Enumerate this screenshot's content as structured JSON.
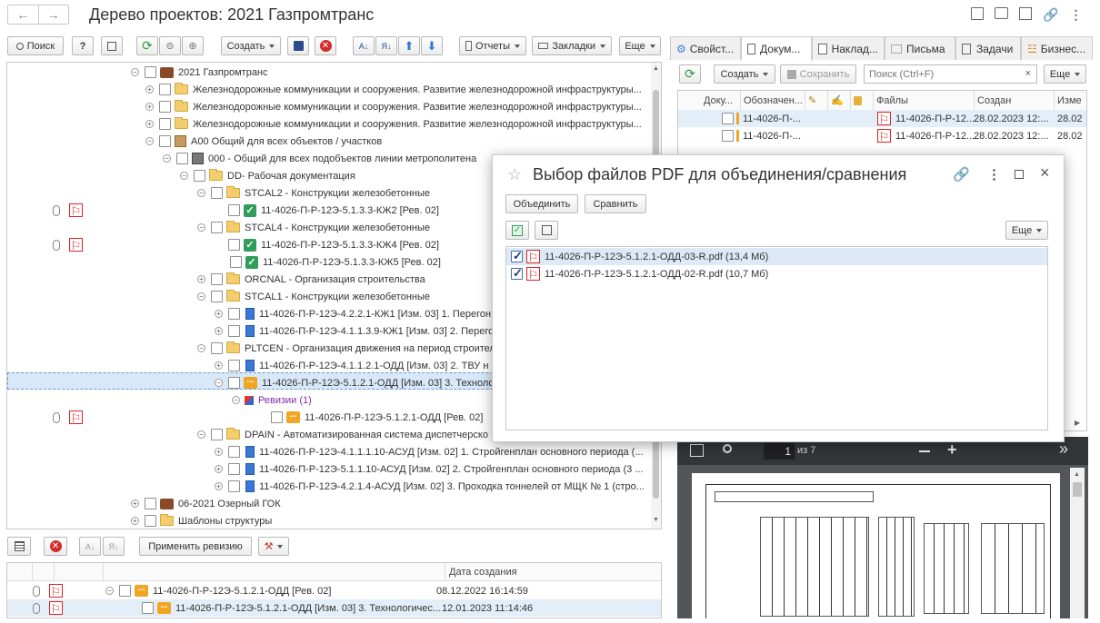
{
  "window": {
    "title": "Дерево проектов: 2021 Газпромтранс"
  },
  "toolbar": {
    "search": "Поиск",
    "help": "?",
    "create": "Создать",
    "reports": "Отчеты",
    "bookmarks": "Закладки",
    "more": "Еще"
  },
  "tree": {
    "rows": [
      {
        "label": "2021 Газпромтранс"
      },
      {
        "label": "Железнодорожные коммуникации и сооружения. Развитие железнодорожной инфраструктуры..."
      },
      {
        "label": "Железнодорожные коммуникации и сооружения. Развитие железнодорожной инфраструктуры..."
      },
      {
        "label": "Железнодорожные коммуникации и сооружения. Развитие железнодорожной инфраструктуры..."
      },
      {
        "label": "А00 Общий для всех объектов / участков"
      },
      {
        "label": "000 - Общий для всех подобъектов линии метрополитена"
      },
      {
        "label": "DD- Рабочая документация"
      },
      {
        "label": "STCAL2 - Конструкции железобетонные"
      },
      {
        "label": "11-4026-П-Р-12Э-5.1.3.3-КЖ2 [Рев. 02]"
      },
      {
        "label": "STCAL4 - Конструкции железобетонные"
      },
      {
        "label": "11-4026-П-Р-12Э-5.1.3.3-КЖ4 [Рев. 02]"
      },
      {
        "label": "11-4026-П-Р-12Э-5.1.3.3-КЖ5 [Рев. 02]"
      },
      {
        "label": "ORCNAL - Организация строительства"
      },
      {
        "label": "STCAL1 - Конструкции железобетонные"
      },
      {
        "label": "11-4026-П-Р-12Э-4.2.2.1-КЖ1 [Изм. 03] 1. Перегон"
      },
      {
        "label": "11-4026-П-Р-12Э-4.1.1.3.9-КЖ1 [Изм. 03] 2. Перего"
      },
      {
        "label": "PLTCEN - Организация движения на период строител"
      },
      {
        "label": "11-4026-П-Р-12Э-4.1.1.2.1-ОДД [Изм. 03] 2. ТВУ н"
      },
      {
        "label": "11-4026-П-Р-12Э-5.1.2.1-ОДД [Изм. 03] 3. Техноло"
      },
      {
        "label": "Ревизии (1)"
      },
      {
        "label": "11-4026-П-Р-12Э-5.1.2.1-ОДД [Рев. 02]"
      },
      {
        "label": "DPAIN - Автоматизированная система диспетчерско"
      },
      {
        "label": "11-4026-П-Р-12Э-4.1.1.1.10-АСУД [Изм. 02] 1. Стройгенплан основного периода (..."
      },
      {
        "label": "11-4026-П-Р-12Э-5.1.1.10-АСУД [Изм. 02] 2. Стройгенплан основного периода (3 ..."
      },
      {
        "label": "11-4026-П-Р-12Э-4.2.1.4-АСУД [Изм. 02] 3. Проходка тоннелей от МЩК № 1 (стро..."
      },
      {
        "label": "06-2021 Озерный ГОК"
      },
      {
        "label": "Шаблоны структуры"
      }
    ]
  },
  "revisions": {
    "apply": "Применить ревизию",
    "col_created": "Дата создания",
    "rows": [
      {
        "name": "11-4026-П-Р-12Э-5.1.2.1-ОДД [Рев. 02]",
        "date": "08.12.2022 16:14:59"
      },
      {
        "name": "11-4026-П-Р-12Э-5.1.2.1-ОДД [Изм. 03] 3. Технологичес...",
        "date": "12.01.2023 11:14:46"
      }
    ]
  },
  "tabs": [
    {
      "label": "Свойст..."
    },
    {
      "label": "Докум..."
    },
    {
      "label": "Наклад..."
    },
    {
      "label": "Письма"
    },
    {
      "label": "Задачи"
    },
    {
      "label": "Бизнес..."
    }
  ],
  "docs": {
    "create": "Создать",
    "save": "Сохранить",
    "search_placeholder": "Поиск (Ctrl+F)",
    "more": "Еще",
    "col_doc": "Доку...",
    "col_designation": "Обозначен...",
    "col_files": "Файлы",
    "col_created": "Создан",
    "col_changed": "Изме",
    "rows": [
      {
        "designation": "11-4026-П-...",
        "file": "11-4026-П-Р-12...",
        "created": "28.02.2023 12:...",
        "changed": "28.02"
      },
      {
        "designation": "11-4026-П-...",
        "file": "11-4026-П-Р-12...",
        "created": "28.02.2023 12:...",
        "changed": "28.02"
      }
    ]
  },
  "pdf_viewer": {
    "page": "1",
    "of": "из 7"
  },
  "dialog": {
    "title": "Выбор файлов PDF для объединения/сравнения",
    "merge": "Объединить",
    "compare": "Сравнить",
    "more": "Еще",
    "files": [
      {
        "name": "11-4026-П-Р-12Э-5.1.2.1-ОДД-03-R.pdf (13,4 Мб)",
        "checked": true
      },
      {
        "name": "11-4026-П-Р-12Э-5.1.2.1-ОДД-02-R.pdf (10,7 Мб)",
        "checked": true
      }
    ]
  }
}
